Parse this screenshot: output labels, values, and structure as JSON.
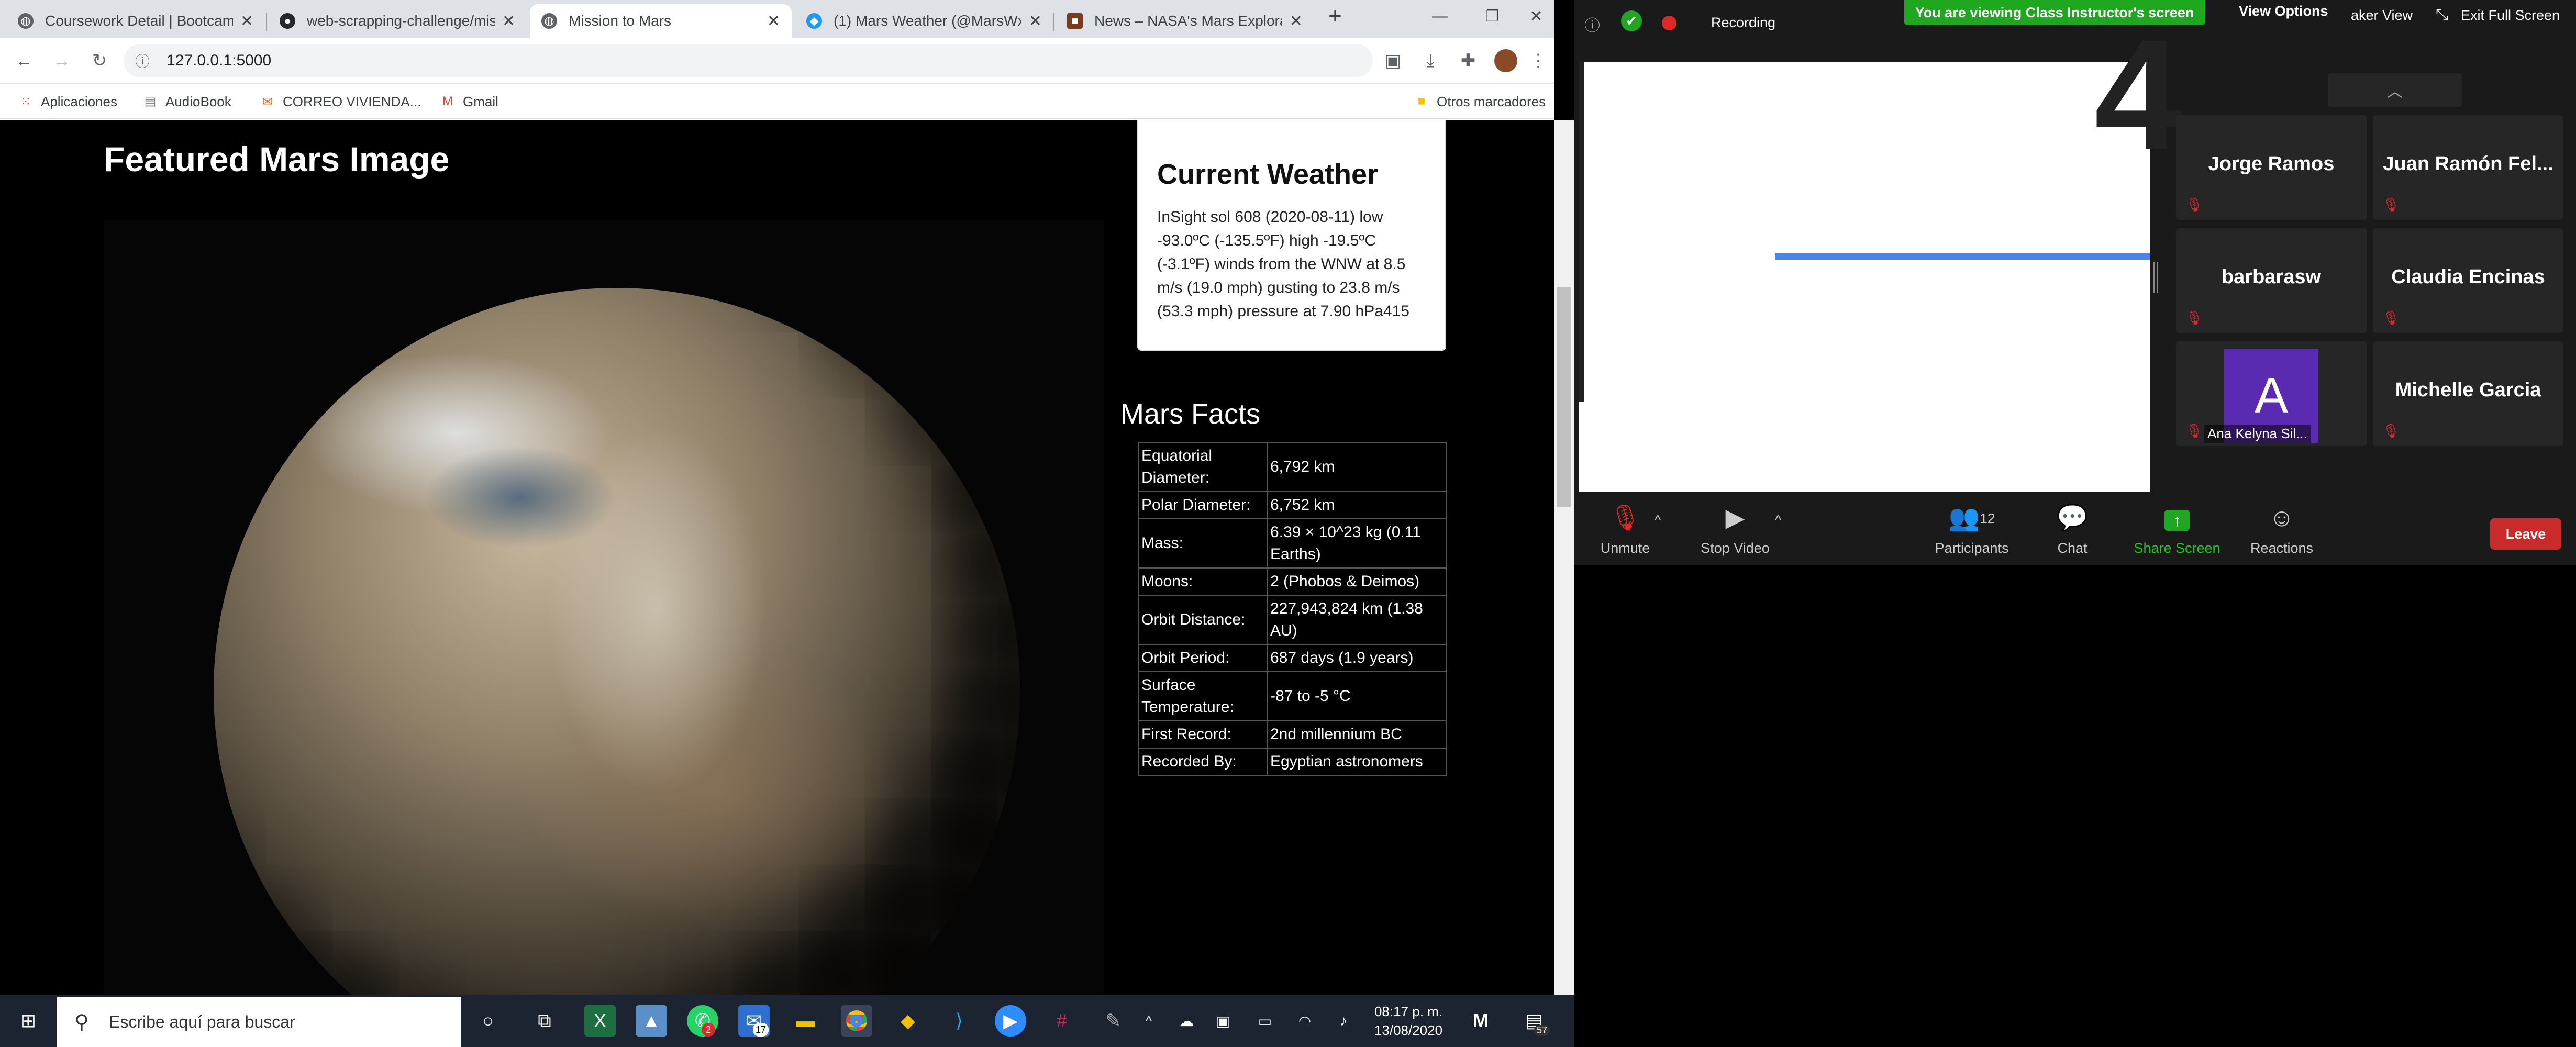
{
  "browser": {
    "tabs": [
      {
        "label": "Coursework Detail | Bootcamp",
        "icon": "globe-icon"
      },
      {
        "label": "web-scrapping-challenge/mis",
        "icon": "github-icon"
      },
      {
        "label": "Mission to Mars",
        "icon": "globe-icon"
      },
      {
        "label": "(1) Mars Weather (@MarsWx",
        "icon": "twitter-icon"
      },
      {
        "label": "News – NASA's Mars Explorat",
        "icon": "nasa-icon"
      }
    ],
    "new_tab": "+",
    "url": "127.0.0.1:5000",
    "bookmarks": [
      {
        "label": "Aplicaciones",
        "icon": "apps-grid-icon"
      },
      {
        "label": "AudioBook",
        "icon": "book-icon"
      },
      {
        "label": "CORREO VIVIENDA...",
        "icon": "mail-icon"
      },
      {
        "label": "Gmail",
        "icon": "gmail-icon"
      }
    ],
    "other_bookmarks": "Otros marcadores"
  },
  "page": {
    "image_title": "Featured Mars Image",
    "weather": {
      "title": "Current Weather",
      "text": "InSight sol 608 (2020-08-11) low -93.0ºC (-135.5ºF) high -19.5ºC (-3.1ºF) winds from the WNW at 8.5 m/s (19.0 mph) gusting to 23.8 m/s (53.3 mph) pressure at 7.90 hPa415"
    },
    "facts": {
      "title": "Mars Facts",
      "rows": [
        [
          "Equatorial Diameter:",
          "6,792 km"
        ],
        [
          "Polar Diameter:",
          "6,752 km"
        ],
        [
          "Mass:",
          "6.39 × 10^23 kg (0.11 Earths)"
        ],
        [
          "Moons:",
          "2 (Phobos & Deimos)"
        ],
        [
          "Orbit Distance:",
          "227,943,824 km (1.38 AU)"
        ],
        [
          "Orbit Period:",
          "687 days (1.9 years)"
        ],
        [
          "Surface Temperature:",
          "-87 to -5 °C"
        ],
        [
          "First Record:",
          "2nd millennium BC"
        ],
        [
          "Recorded By:",
          "Egyptian astronomers"
        ]
      ]
    }
  },
  "zoom": {
    "recording": "Recording",
    "banner": "You are viewing Class Instructor's screen",
    "view_options": "View Options",
    "speaker_view": "aker View",
    "exit_fullscreen": "Exit Full Screen",
    "participants": [
      {
        "name": "Jorge Ramos"
      },
      {
        "name": "Juan Ramón Fel..."
      },
      {
        "name": "barbarasw"
      },
      {
        "name": "Claudia Encinas"
      },
      {
        "name": "Ana Kelyna Sil...",
        "avatar": "A"
      },
      {
        "name": "Michelle Garcia"
      }
    ],
    "controls": {
      "unmute": "Unmute",
      "stop_video": "Stop Video",
      "participants": "Participants",
      "participants_count": "12",
      "chat": "Chat",
      "share_screen": "Share Screen",
      "reactions": "Reactions",
      "leave": "Leave"
    },
    "shared_char": "4"
  },
  "taskbar": {
    "search_placeholder": "Escribe aquí para buscar",
    "time": "08:17 p. m.",
    "date": "13/08/2020",
    "notifications": "57",
    "mail_badge": "17",
    "whatsapp_badge": "2"
  },
  "colors": {
    "zoom_green": "#1fa81f",
    "leave_red": "#c92a2a",
    "chrome_tab": "#dee1e6",
    "link_blue": "#4a86e8"
  }
}
